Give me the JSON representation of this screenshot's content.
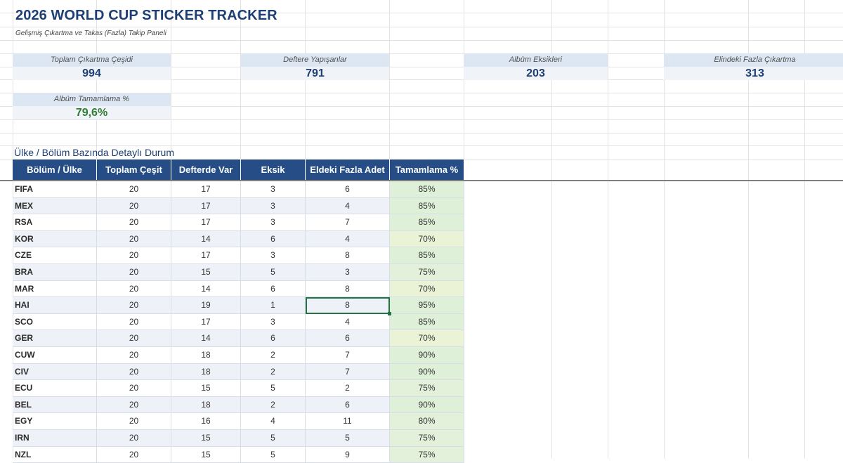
{
  "title": "2026 WORLD CUP STICKER TRACKER",
  "subtitle": "Gelişmiş Çıkartma ve Takas (Fazla) Takip Paneli",
  "kpis": {
    "total_types": {
      "label": "Toplam Çıkartma Çeşidi",
      "value": "994"
    },
    "stuck": {
      "label": "Deftere Yapışanlar",
      "value": "791"
    },
    "missing": {
      "label": "Albüm Eksikleri",
      "value": "203"
    },
    "extras": {
      "label": "Elindeki Fazla Çıkartma",
      "value": "313"
    },
    "completion": {
      "label": "Albüm Tamamlama %",
      "value": "79,6%"
    }
  },
  "section_title": "Ülke / Bölüm Bazında Detaylı Durum",
  "table": {
    "headers": [
      "Bölüm / Ülke",
      "Toplam Çeşit",
      "Defterde Var",
      "Eksik",
      "Eldeki Fazla Adet",
      "Tamamlama %"
    ],
    "rows": [
      [
        "FIFA",
        "20",
        "17",
        "3",
        "6",
        "85%"
      ],
      [
        "MEX",
        "20",
        "17",
        "3",
        "4",
        "85%"
      ],
      [
        "RSA",
        "20",
        "17",
        "3",
        "7",
        "85%"
      ],
      [
        "KOR",
        "20",
        "14",
        "6",
        "4",
        "70%"
      ],
      [
        "CZE",
        "20",
        "17",
        "3",
        "8",
        "85%"
      ],
      [
        "BRA",
        "20",
        "15",
        "5",
        "3",
        "75%"
      ],
      [
        "MAR",
        "20",
        "14",
        "6",
        "8",
        "70%"
      ],
      [
        "HAI",
        "20",
        "19",
        "1",
        "8",
        "95%"
      ],
      [
        "SCO",
        "20",
        "17",
        "3",
        "4",
        "85%"
      ],
      [
        "GER",
        "20",
        "14",
        "6",
        "6",
        "70%"
      ],
      [
        "CUW",
        "20",
        "18",
        "2",
        "7",
        "90%"
      ],
      [
        "CIV",
        "20",
        "18",
        "2",
        "7",
        "90%"
      ],
      [
        "ECU",
        "20",
        "15",
        "5",
        "2",
        "75%"
      ],
      [
        "BEL",
        "20",
        "18",
        "2",
        "6",
        "90%"
      ],
      [
        "EGY",
        "20",
        "16",
        "4",
        "11",
        "80%"
      ],
      [
        "IRN",
        "20",
        "15",
        "5",
        "5",
        "75%"
      ],
      [
        "NZL",
        "20",
        "15",
        "5",
        "9",
        "75%"
      ]
    ],
    "selected_cell": {
      "row": 7,
      "col": 4
    }
  },
  "colors": {
    "header_bg": "#264d86",
    "title": "#1e3f73",
    "selection": "#217346",
    "completion_green": "#2e7d32"
  }
}
